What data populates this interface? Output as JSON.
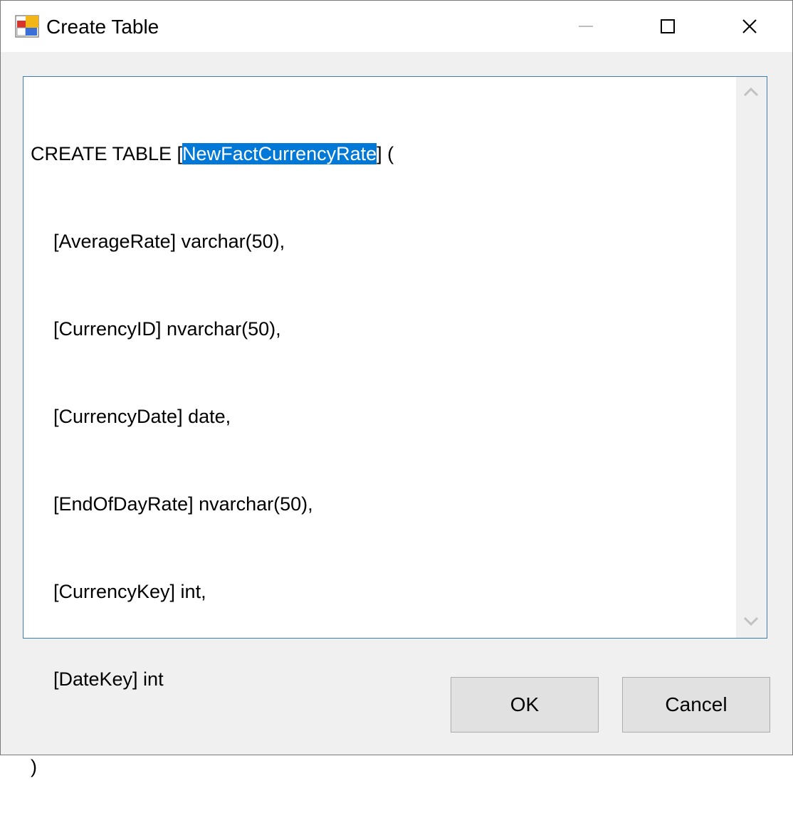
{
  "window": {
    "title": "Create Table",
    "icon": "table-app-icon",
    "controls": {
      "minimize": "minimize-icon",
      "maximize": "maximize-icon",
      "close": "close-icon"
    }
  },
  "editor": {
    "line1_prefix": "CREATE TABLE [",
    "line1_selected": "NewFactCurrencyRate",
    "line1_suffix": "] (",
    "columns": [
      "[AverageRate] varchar(50),",
      "[CurrencyID] nvarchar(50),",
      "[CurrencyDate] date,",
      "[EndOfDayRate] nvarchar(50),",
      "[CurrencyKey] int,",
      "[DateKey] int"
    ],
    "closing": ")",
    "selection_color": "#0078d7"
  },
  "buttons": {
    "ok": "OK",
    "cancel": "Cancel"
  }
}
